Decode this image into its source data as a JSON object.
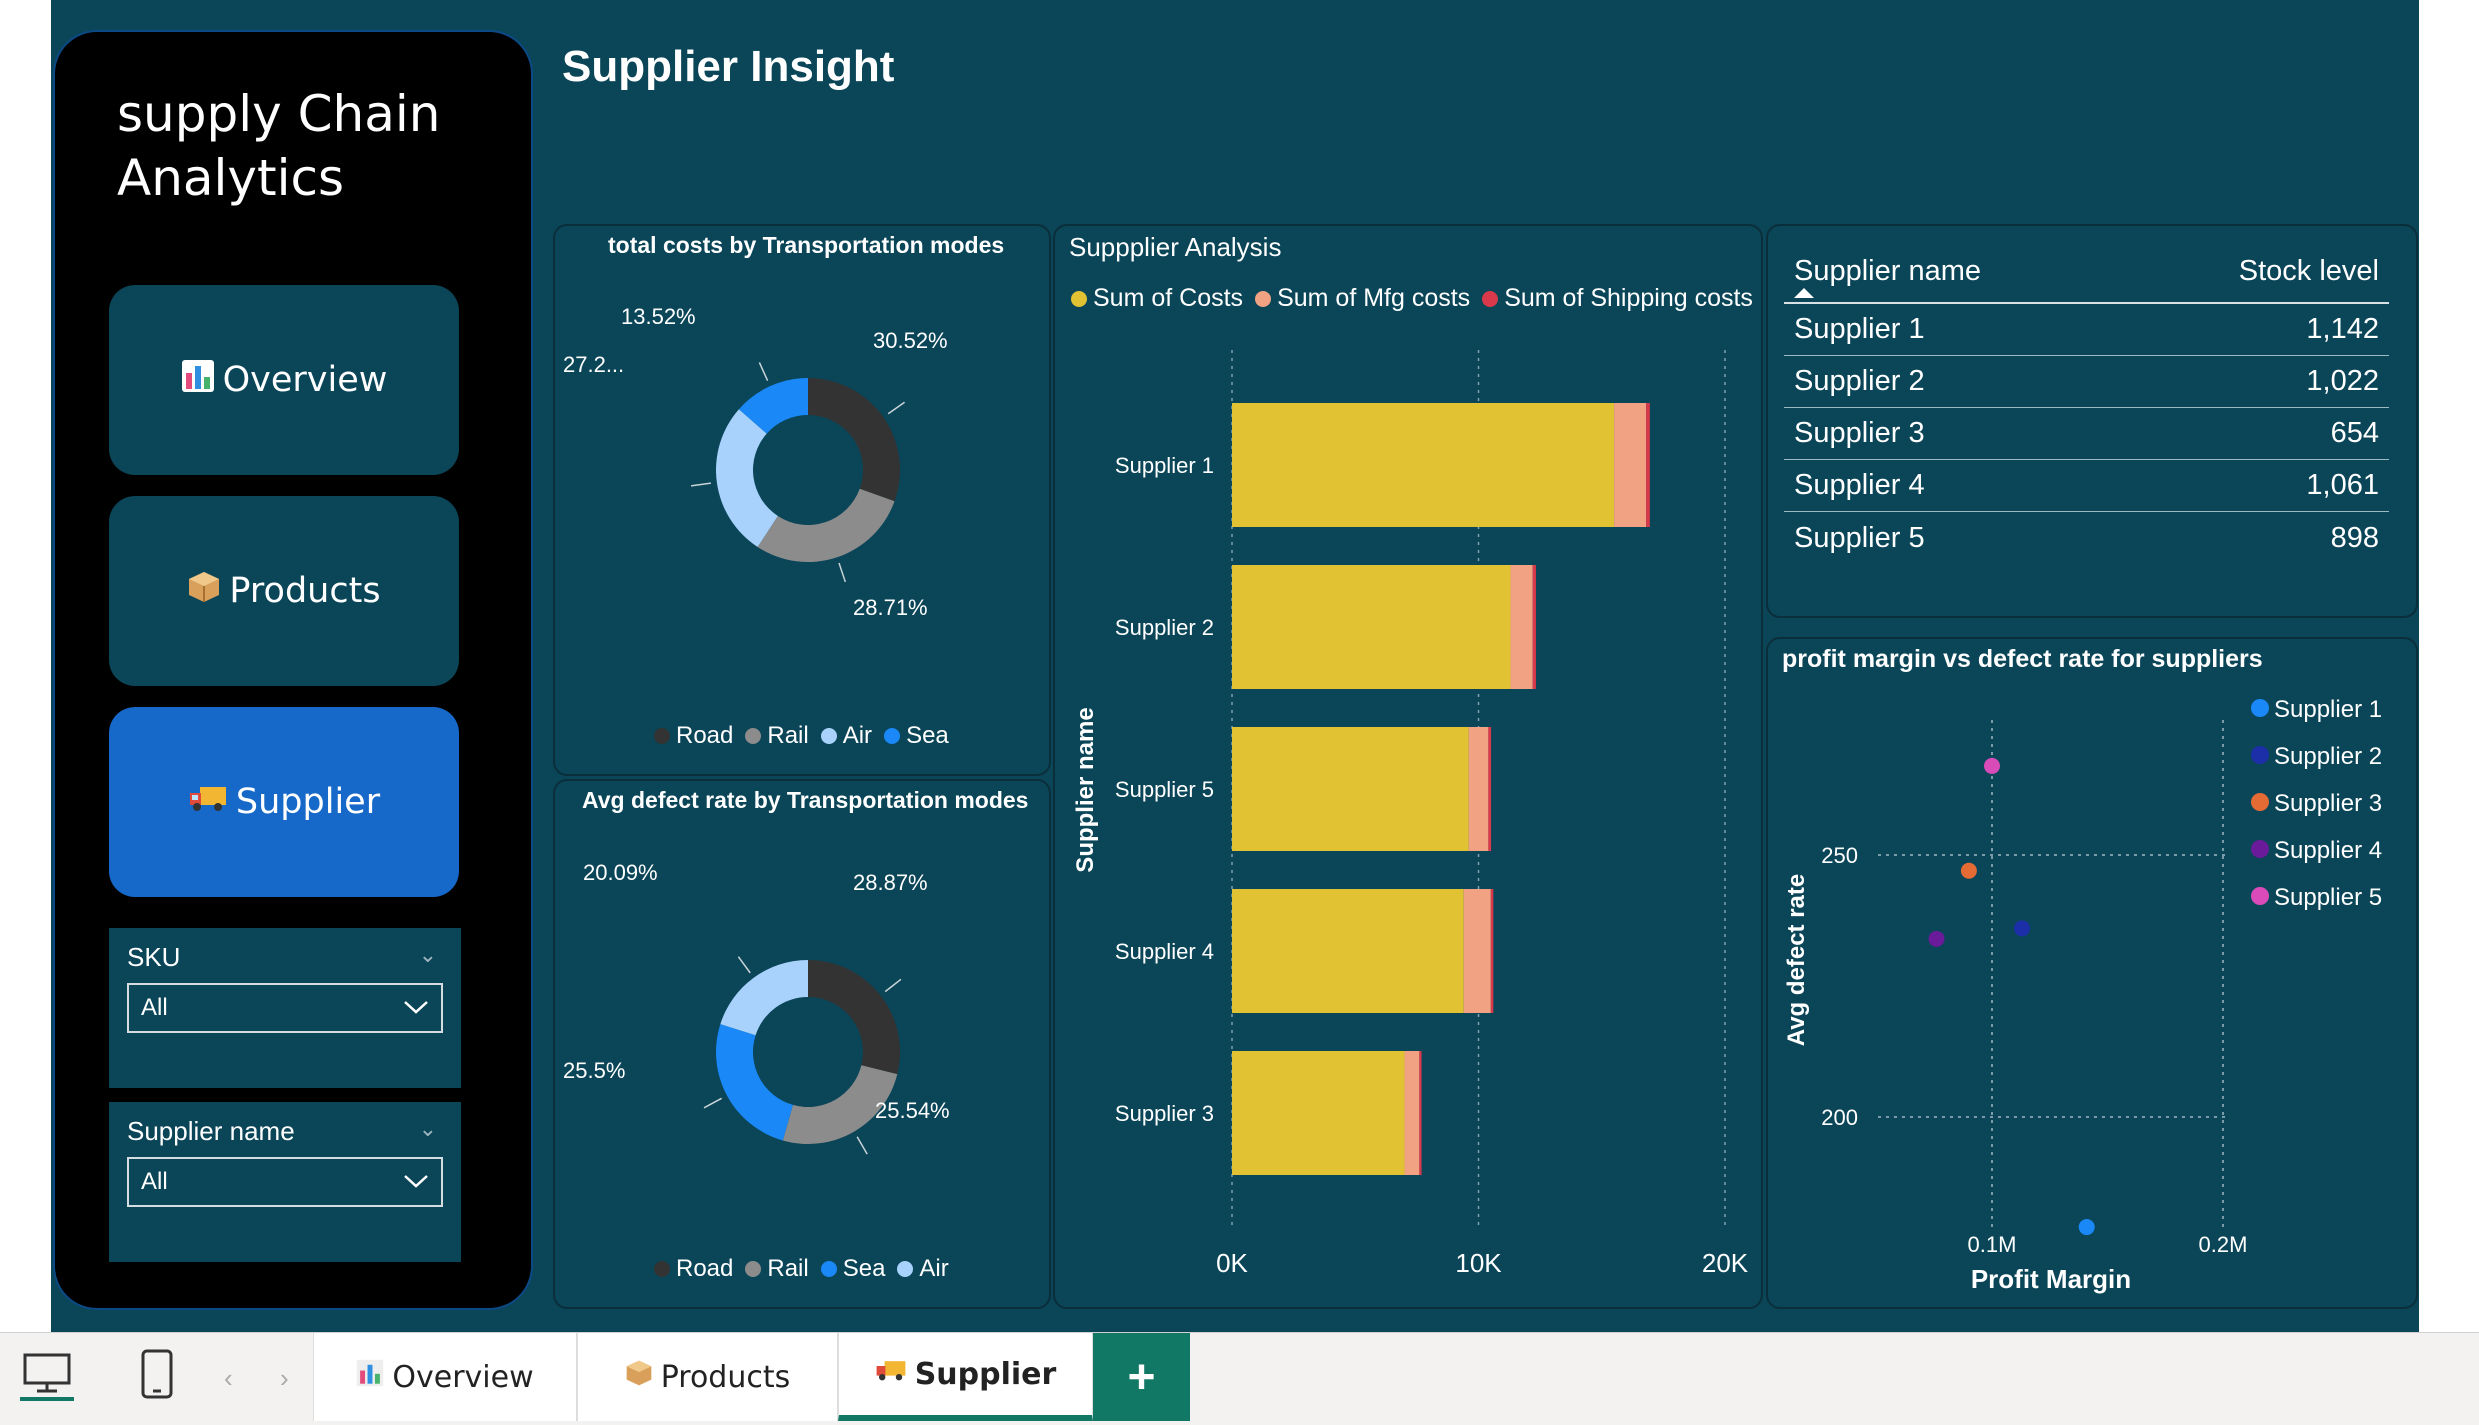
{
  "app": {
    "title_line1": "supply Chain",
    "title_line2": "Analytics",
    "page_title": "Supplier Insight"
  },
  "nav": [
    {
      "label": "Overview",
      "icon": "bar-chart-icon"
    },
    {
      "label": "Products",
      "icon": "package-icon"
    },
    {
      "label": "Supplier",
      "icon": "truck-icon"
    }
  ],
  "slicers": [
    {
      "label": "SKU",
      "value": "All"
    },
    {
      "label": "Supplier name",
      "value": "All"
    }
  ],
  "colors": {
    "road": "#333333",
    "rail": "#8c8c8c",
    "air": "#a8d2fb",
    "sea": "#1a88f7",
    "costs": "#e0c232",
    "mfg": "#f0a283",
    "shipping": "#d9394a",
    "background": "#0a4558",
    "active_nav": "#1769c9",
    "add_tab": "#117865"
  },
  "donut1": {
    "title": "total costs by Transportation modes",
    "legend": [
      "Road",
      "Rail",
      "Air",
      "Sea"
    ],
    "labels": [
      "30.52%",
      "28.71%",
      "27.2...",
      "13.52%"
    ]
  },
  "donut2": {
    "title": "Avg defect rate by Transportation modes",
    "legend": [
      "Road",
      "Rail",
      "Sea",
      "Air"
    ],
    "labels": [
      "28.87%",
      "25.54%",
      "25.5%",
      "20.09%"
    ]
  },
  "bar_panel": {
    "title": "Suppplier Analysis",
    "legend": [
      "Sum of Costs",
      "Sum of Mfg costs",
      "Sum of Shipping costs"
    ],
    "ylabel": "Supplier name"
  },
  "table": {
    "headers": [
      "Supplier name",
      "Stock level"
    ],
    "rows": [
      [
        "Supplier 1",
        "1,142"
      ],
      [
        "Supplier 2",
        "1,022"
      ],
      [
        "Supplier 3",
        "654"
      ],
      [
        "Supplier 4",
        "1,061"
      ],
      [
        "Supplier 5",
        "898"
      ]
    ]
  },
  "scatter_panel": {
    "title": "profit margin vs defect rate for suppliers",
    "legend": [
      "Supplier 1",
      "Supplier 2",
      "Supplier 3",
      "Supplier 4",
      "Supplier 5"
    ],
    "xlabel": "Profit Margin",
    "ylabel": "Avg defect rate"
  },
  "bottom_tabs": [
    "Overview",
    "Products",
    "Supplier"
  ],
  "add_tab_label": "+",
  "chart_data": [
    {
      "type": "pie",
      "title": "total costs by Transportation modes",
      "categories": [
        "Road",
        "Rail",
        "Air",
        "Sea"
      ],
      "values": [
        30.52,
        28.71,
        27.25,
        13.52
      ]
    },
    {
      "type": "pie",
      "title": "Avg defect rate by Transportation modes",
      "categories": [
        "Road",
        "Rail",
        "Sea",
        "Air"
      ],
      "values": [
        28.87,
        25.54,
        25.5,
        20.09
      ]
    },
    {
      "type": "bar",
      "title": "Suppplier Analysis",
      "orientation": "horizontal",
      "stacked": true,
      "categories": [
        "Supplier 1",
        "Supplier 2",
        "Supplier 5",
        "Supplier 4",
        "Supplier 3"
      ],
      "series": [
        {
          "name": "Sum of Costs",
          "values": [
            15500,
            11300,
            9600,
            9400,
            7000
          ]
        },
        {
          "name": "Sum of Mfg costs",
          "values": [
            1300,
            900,
            800,
            1100,
            600
          ]
        },
        {
          "name": "Sum of Shipping costs",
          "values": [
            150,
            130,
            110,
            100,
            90
          ]
        }
      ],
      "xticks": [
        "0K",
        "10K",
        "20K"
      ],
      "xlim": [
        0,
        20000
      ],
      "ylabel": "Supplier name",
      "grid": true,
      "legend_position": "top"
    },
    {
      "type": "scatter",
      "title": "profit margin vs defect rate for suppliers",
      "series": [
        {
          "name": "Supplier 1",
          "x": [
            0.141
          ],
          "y": [
            179
          ]
        },
        {
          "name": "Supplier 2",
          "x": [
            0.113
          ],
          "y": [
            236
          ]
        },
        {
          "name": "Supplier 3",
          "x": [
            0.09
          ],
          "y": [
            247
          ]
        },
        {
          "name": "Supplier 4",
          "x": [
            0.076
          ],
          "y": [
            234
          ]
        },
        {
          "name": "Supplier 5",
          "x": [
            0.1
          ],
          "y": [
            267
          ]
        }
      ],
      "series_colors": [
        "#1a88f7",
        "#1c2fa8",
        "#e56b35",
        "#6a1b9a",
        "#d94bb8"
      ],
      "xlabel": "Profit Margin",
      "ylabel": "Avg defect rate",
      "xticks": [
        "0.1M",
        "0.2M"
      ],
      "yticks": [
        "200",
        "250"
      ],
      "xlim": [
        0,
        0.25
      ],
      "ylim": [
        180,
        272
      ],
      "legend_position": "right"
    }
  ]
}
